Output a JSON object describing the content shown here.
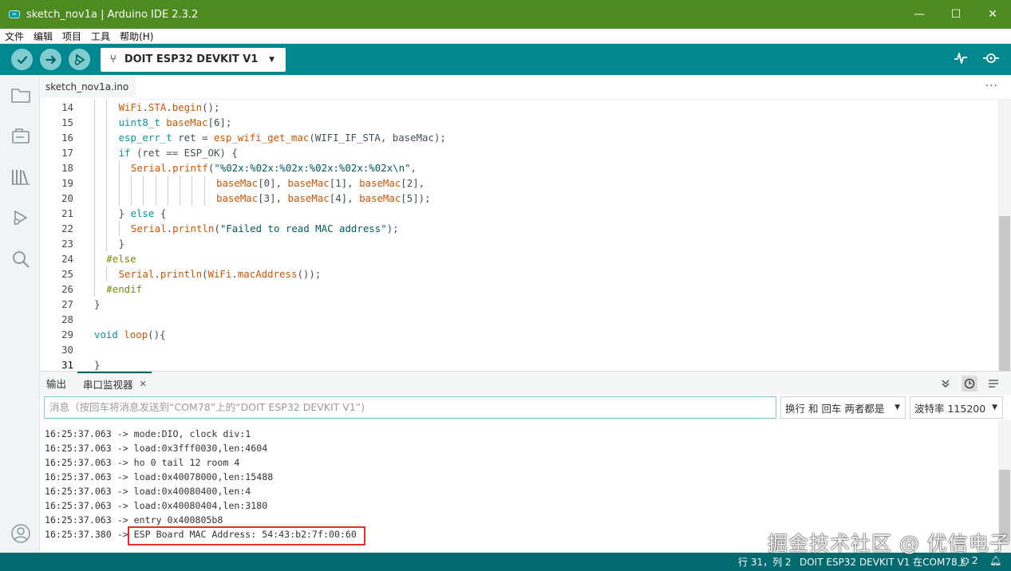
{
  "window": {
    "title": "sketch_nov1a | Arduino IDE 2.3.2",
    "logo_text": "∞",
    "minimize": "—",
    "maximize": "☐",
    "close": "✕"
  },
  "menu": [
    "文件",
    "编辑",
    "项目",
    "工具",
    "帮助(H)"
  ],
  "toolbar": {
    "board": "DOIT ESP32 DEVKIT V1",
    "verify_icon": "check-icon",
    "upload_icon": "arrow-right-icon",
    "debug_icon": "debug-icon"
  },
  "editor": {
    "tab": "sketch_nov1a.ino",
    "more": "···",
    "lines": [
      {
        "n": "14",
        "indent": 2,
        "html": "<span class=\"fn\">WiFi</span>.<span class=\"fn\">STA</span>.<span class=\"fn\">begin</span>();"
      },
      {
        "n": "15",
        "indent": 2,
        "html": "<span class=\"kw\">uint8_t</span> <span class=\"fn\">baseMac</span>[6];"
      },
      {
        "n": "16",
        "indent": 2,
        "html": "<span class=\"kw\">esp_err_t</span> ret = <span class=\"fn\">esp_wifi_get_mac</span>(WIFI_IF_STA, baseMac);"
      },
      {
        "n": "17",
        "indent": 2,
        "html": "<span class=\"kw\">if</span> (ret == ESP_OK) {"
      },
      {
        "n": "18",
        "indent": 3,
        "html": "<span class=\"fn\">Serial</span>.<span class=\"fn\">printf</span>(<span class=\"str\">\"%02x:%02x:%02x:%02x:%02x:%02x\\n\"</span>,"
      },
      {
        "n": "19",
        "indent": 10,
        "html": "<span class=\"fn\">baseMac</span>[0], <span class=\"fn\">baseMac</span>[1], <span class=\"fn\">baseMac</span>[2],"
      },
      {
        "n": "20",
        "indent": 10,
        "html": "<span class=\"fn\">baseMac</span>[3], <span class=\"fn\">baseMac</span>[4], <span class=\"fn\">baseMac</span>[5]);"
      },
      {
        "n": "21",
        "indent": 2,
        "html": "} <span class=\"kw\">else</span> {"
      },
      {
        "n": "22",
        "indent": 3,
        "html": "<span class=\"fn\">Serial</span>.<span class=\"fn\">println</span>(<span class=\"str\">\"Failed to read MAC address\"</span>);"
      },
      {
        "n": "23",
        "indent": 2,
        "html": "}"
      },
      {
        "n": "24",
        "indent": 1,
        "html": "<span class=\"pp\">#else</span>"
      },
      {
        "n": "25",
        "indent": 2,
        "html": "<span class=\"fn\">Serial</span>.<span class=\"fn\">println</span>(<span class=\"fn\">WiFi</span>.<span class=\"fn\">macAddress</span>());"
      },
      {
        "n": "26",
        "indent": 1,
        "html": "<span class=\"pp\">#endif</span>"
      },
      {
        "n": "27",
        "indent": 0,
        "html": "}"
      },
      {
        "n": "28",
        "indent": 0,
        "html": ""
      },
      {
        "n": "29",
        "indent": 0,
        "html": "<span class=\"kw\">void</span> <span class=\"fn\">loop</span>(){"
      },
      {
        "n": "30",
        "indent": 0,
        "html": ""
      },
      {
        "n": "31",
        "indent": 0,
        "html": "}"
      }
    ],
    "active_line": "31"
  },
  "panel": {
    "tab_output": "输出",
    "tab_serial": "串口监视器",
    "tab_close": "✕",
    "message_placeholder": "消息（按回车将消息发送到“COM78”上的“DOIT ESP32 DEVKIT V1”)",
    "line_ending": "换行 和 回车 两者都是",
    "baud": "波特率 115200",
    "serial_lines": [
      "16:25:37.063 -> mode:DIO, clock div:1",
      "16:25:37.063 -> load:0x3fff0030,len:4604",
      "16:25:37.063 -> ho 0 tail 12 room 4",
      "16:25:37.063 -> load:0x40078000,len:15488",
      "16:25:37.063 -> load:0x40080400,len:4",
      "16:25:37.063 -> load:0x40080404,len:3180",
      "16:25:37.063 -> entry 0x400805b8",
      "16:25:37.380 -> ESP Board MAC Address: 54:43:b2:7f:00:60"
    ]
  },
  "status": {
    "position": "行 31，列 2",
    "board_port": "DOIT ESP32 DEVKIT V1 在COM78上",
    "notifications": "2"
  },
  "watermark": "掘金技术社区 @ 优信电子",
  "colors": {
    "titlebar": "#4d8a1f",
    "toolbar": "#00878f",
    "statusbar": "#006a6e",
    "highlight": "#e0302b"
  }
}
